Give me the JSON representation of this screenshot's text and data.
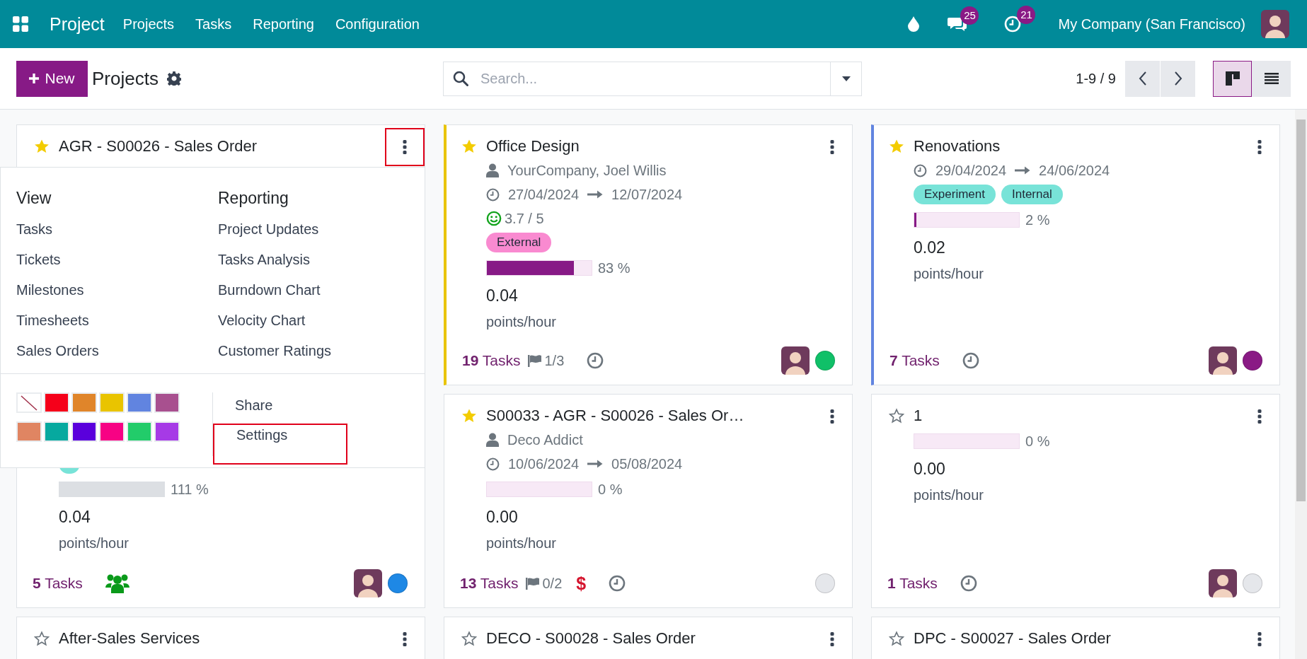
{
  "navbar": {
    "app_name": "Project",
    "menu": [
      "Projects",
      "Tasks",
      "Reporting",
      "Configuration"
    ],
    "messages_count": "25",
    "activities_count": "21",
    "company": "My Company (San Francisco)"
  },
  "control_panel": {
    "new_button": "New",
    "title": "Projects",
    "search": {
      "placeholder": "Search..."
    },
    "pager": "1-9 / 9",
    "views": [
      {
        "kind": "kanban",
        "selected": true
      },
      {
        "kind": "list",
        "selected": false
      }
    ]
  },
  "projects": [
    {
      "name": "AGR - S00026 - Sales Order",
      "favorite": true,
      "menu_highlighted": true,
      "menu": {
        "sections": [
          {
            "title": "View",
            "items": [
              "Tasks",
              "Tickets",
              "Milestones",
              "Timesheets",
              "Sales Orders"
            ]
          },
          {
            "title": "Reporting",
            "items": [
              "Project Updates",
              "Tasks Analysis",
              "Burndown Chart",
              "Velocity Chart",
              "Customer Ratings"
            ]
          }
        ],
        "colors": [
          {
            "kind": "none"
          },
          {
            "kind": "swatch",
            "color": "#f5001a"
          },
          {
            "kind": "swatch",
            "color": "#e0852a"
          },
          {
            "kind": "swatch",
            "color": "#e9c400"
          },
          {
            "kind": "swatch",
            "color": "#6184e0"
          },
          {
            "kind": "swatch",
            "color": "#a8508f"
          },
          {
            "kind": "swatch",
            "color": "#e08562"
          },
          {
            "kind": "swatch",
            "color": "#06a99f"
          },
          {
            "kind": "swatch",
            "color": "#5a00dc"
          },
          {
            "kind": "swatch",
            "color": "#f70284"
          },
          {
            "kind": "swatch",
            "color": "#22cc6a"
          },
          {
            "kind": "swatch",
            "color": "#a63ae6"
          }
        ],
        "actions": [
          {
            "label": "Share",
            "highlighted": false
          },
          {
            "label": "Settings",
            "highlighted": true
          }
        ]
      }
    },
    {
      "name": "Office Design",
      "favorite": true,
      "color": "#e9c400",
      "customer": "YourCompany, Joel Willis",
      "dates": {
        "start": "27/04/2024",
        "end": "12/07/2024"
      },
      "rating": "3.7 / 5",
      "tags": [
        {
          "label": "External",
          "color": "#f98ad0"
        }
      ],
      "progress": {
        "level": 0.83,
        "label": "83 %",
        "overrun": false
      },
      "velocity": "0.04",
      "velocity_unit": "points/hour",
      "tasks": "**19** Tasks",
      "milestones": "1/3",
      "activity": {
        "kind": "clock"
      },
      "avatar": true,
      "status_dot": {
        "color": "#10c068"
      }
    },
    {
      "name": "Renovations",
      "favorite": true,
      "color": "#6184e0",
      "dates": {
        "start": "29/04/2024",
        "end": "24/06/2024"
      },
      "tags": [
        {
          "label": "Experiment",
          "color": "#78e3d8"
        },
        {
          "label": "Internal",
          "color": "#78e3d8"
        }
      ],
      "progress": {
        "level": 0.02,
        "label": "2 %",
        "overrun": false
      },
      "velocity": "0.02",
      "velocity_unit": "points/hour",
      "tasks": "**7** Tasks",
      "activity": {
        "kind": "clock"
      },
      "avatar": true,
      "status_dot": {
        "color": "#8a1a85"
      }
    },
    {
      "tags": [
        {
          "color": "#78e3d8"
        }
      ],
      "progress": {
        "level": 1,
        "label": "111 %",
        "overrun": true
      },
      "velocity": "0.04",
      "velocity_unit": "points/hour",
      "tasks": "**5** Tasks",
      "activity": {
        "kind": "people"
      },
      "avatar": true,
      "status_dot": {
        "color": "#1e88e5"
      }
    },
    {
      "name": "S00033 - AGR - S00026 - Sales Or…",
      "favorite": true,
      "customer": "Deco Addict",
      "dates": {
        "start": "10/06/2024",
        "end": "05/08/2024"
      },
      "progress": {
        "level": 0,
        "label": "0 %",
        "overrun": false
      },
      "velocity": "0.00",
      "velocity_unit": "points/hour",
      "tasks": "**13** Tasks",
      "milestones": "0/2",
      "invoice": "$",
      "activity": {
        "kind": "clock"
      },
      "avatar": false,
      "status_dot": {
        "color": "#e5e7eb"
      }
    },
    {
      "name": "1",
      "favorite": false,
      "progress": {
        "level": 0,
        "label": "0 %",
        "overrun": false
      },
      "velocity": "0.00",
      "velocity_unit": "points/hour",
      "tasks": "**1** Tasks",
      "activity": {
        "kind": "clock"
      },
      "avatar": true,
      "status_dot": {
        "color": "#e5e7eb"
      }
    },
    {
      "name": "After-Sales Services",
      "favorite": false
    },
    {
      "name": "DECO - S00028 - Sales Order",
      "favorite": false
    },
    {
      "name": "DPC - S00027 - Sales Order",
      "favorite": false
    }
  ]
}
